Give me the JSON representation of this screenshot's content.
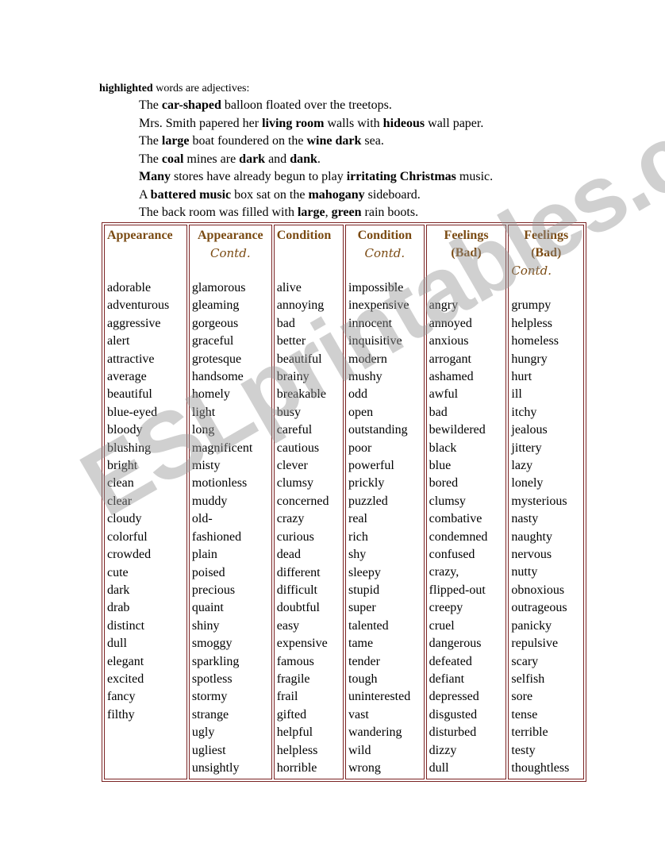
{
  "intro": {
    "bold": "highlighted",
    "rest": " words are adjectives:"
  },
  "sentences": [
    [
      {
        "t": "The ",
        "b": false
      },
      {
        "t": "car-shaped",
        "b": true
      },
      {
        "t": " balloon floated over the treetops.",
        "b": false
      }
    ],
    [
      {
        "t": "Mrs. Smith papered her ",
        "b": false
      },
      {
        "t": "living room",
        "b": true
      },
      {
        "t": " walls with ",
        "b": false
      },
      {
        "t": "hideous",
        "b": true
      },
      {
        "t": " wall paper.",
        "b": false
      }
    ],
    [
      {
        "t": "The ",
        "b": false
      },
      {
        "t": "large",
        "b": true
      },
      {
        "t": " boat foundered on the ",
        "b": false
      },
      {
        "t": "wine dark",
        "b": true
      },
      {
        "t": " sea.",
        "b": false
      }
    ],
    [
      {
        "t": "The ",
        "b": false
      },
      {
        "t": "coal",
        "b": true
      },
      {
        "t": " mines are ",
        "b": false
      },
      {
        "t": "dark",
        "b": true
      },
      {
        "t": " and ",
        "b": false
      },
      {
        "t": "dank",
        "b": true
      },
      {
        "t": ".",
        "b": false
      }
    ],
    [
      {
        "t": "Many",
        "b": true
      },
      {
        "t": " stores have already begun to play ",
        "b": false
      },
      {
        "t": "irritating Christmas",
        "b": true
      },
      {
        "t": " music.",
        "b": false
      }
    ],
    [
      {
        "t": "A ",
        "b": false
      },
      {
        "t": "battered music",
        "b": true
      },
      {
        "t": " box sat on the ",
        "b": false
      },
      {
        "t": "mahogany",
        "b": true
      },
      {
        "t": " sideboard.",
        "b": false
      }
    ],
    [
      {
        "t": "The back room was filled with ",
        "b": false
      },
      {
        "t": "large",
        "b": true
      },
      {
        "t": ", ",
        "b": false
      },
      {
        "t": "green",
        "b": true
      },
      {
        "t": " rain boots.",
        "b": false
      }
    ]
  ],
  "table": {
    "columns": [
      {
        "header": "Appearance",
        "header2": "",
        "contd": "",
        "skip": 0,
        "words": [
          "adorable",
          "adventurous",
          "aggressive",
          "alert",
          "attractive",
          "average",
          "beautiful",
          "blue-eyed",
          "bloody",
          "blushing",
          "bright",
          "clean",
          "clear",
          "cloudy",
          "colorful",
          "crowded",
          "cute",
          "dark",
          "drab",
          "distinct",
          "dull",
          "elegant",
          "excited",
          "fancy",
          "filthy"
        ]
      },
      {
        "header": "Appearance",
        "header2": "",
        "contd": "Contd.",
        "skip": 0,
        "words": [
          "glamorous",
          "gleaming",
          "gorgeous",
          "graceful",
          "grotesque",
          "handsome",
          "homely",
          "light",
          "long",
          "magnificent",
          "misty",
          "motionless",
          "muddy",
          "old-",
          "fashioned",
          "plain",
          "poised",
          "precious",
          "quaint",
          "shiny",
          "smoggy",
          "sparkling",
          "spotless",
          "stormy",
          "strange",
          "ugly",
          "ugliest",
          "unsightly"
        ]
      },
      {
        "header": "Condition",
        "header2": "",
        "contd": "",
        "skip": 0,
        "words": [
          "alive",
          "annoying",
          "bad",
          "better",
          "beautiful",
          "brainy",
          "breakable",
          "busy",
          "careful",
          "cautious",
          "clever",
          "clumsy",
          "concerned",
          "crazy",
          "curious",
          "dead",
          "different",
          "difficult",
          "doubtful",
          "easy",
          "expensive",
          "famous",
          "fragile",
          "frail",
          "gifted",
          "helpful",
          "helpless",
          "horrible"
        ]
      },
      {
        "header": "Condition",
        "header2": "",
        "contd": "Contd.",
        "skip": 0,
        "words": [
          "impossible",
          "inexpensive",
          "innocent",
          "inquisitive",
          "modern",
          "mushy",
          "odd",
          "open",
          "outstanding",
          "poor",
          "powerful",
          "prickly",
          "puzzled",
          "real",
          "rich",
          "shy",
          "sleepy",
          "stupid",
          "super",
          "talented",
          "tame",
          "tender",
          "tough",
          "uninterested",
          "vast",
          "wandering",
          "wild",
          "wrong"
        ]
      },
      {
        "header": "Feelings",
        "header2": "(Bad)",
        "contd": "",
        "skip": 1,
        "words": [
          "angry",
          "annoyed",
          "anxious",
          "arrogant",
          "ashamed",
          "awful",
          "bad",
          "bewildered",
          "black",
          "blue",
          "bored",
          "clumsy",
          "combative",
          "condemned",
          "confused",
          "crazy,",
          "flipped-out",
          "creepy",
          "cruel",
          "dangerous",
          "defeated",
          "defiant",
          "depressed",
          "disgusted",
          "disturbed",
          "dizzy",
          "dull"
        ]
      },
      {
        "header": "Feelings",
        "header2": "(Bad)",
        "contd": "Contd.",
        "skip": 1,
        "words": [
          "grumpy",
          "helpless",
          "homeless",
          "hungry",
          "hurt",
          "ill",
          "itchy",
          "jealous",
          "jittery",
          "lazy",
          "lonely",
          "mysterious",
          "nasty",
          "naughty",
          "nervous",
          "nutty",
          "obnoxious",
          "outrageous",
          "panicky",
          "repulsive",
          "scary",
          "selfish",
          "sore",
          "tense",
          "terrible",
          "testy",
          "thoughtless"
        ]
      }
    ]
  },
  "watermark": "ESLprintables.com"
}
